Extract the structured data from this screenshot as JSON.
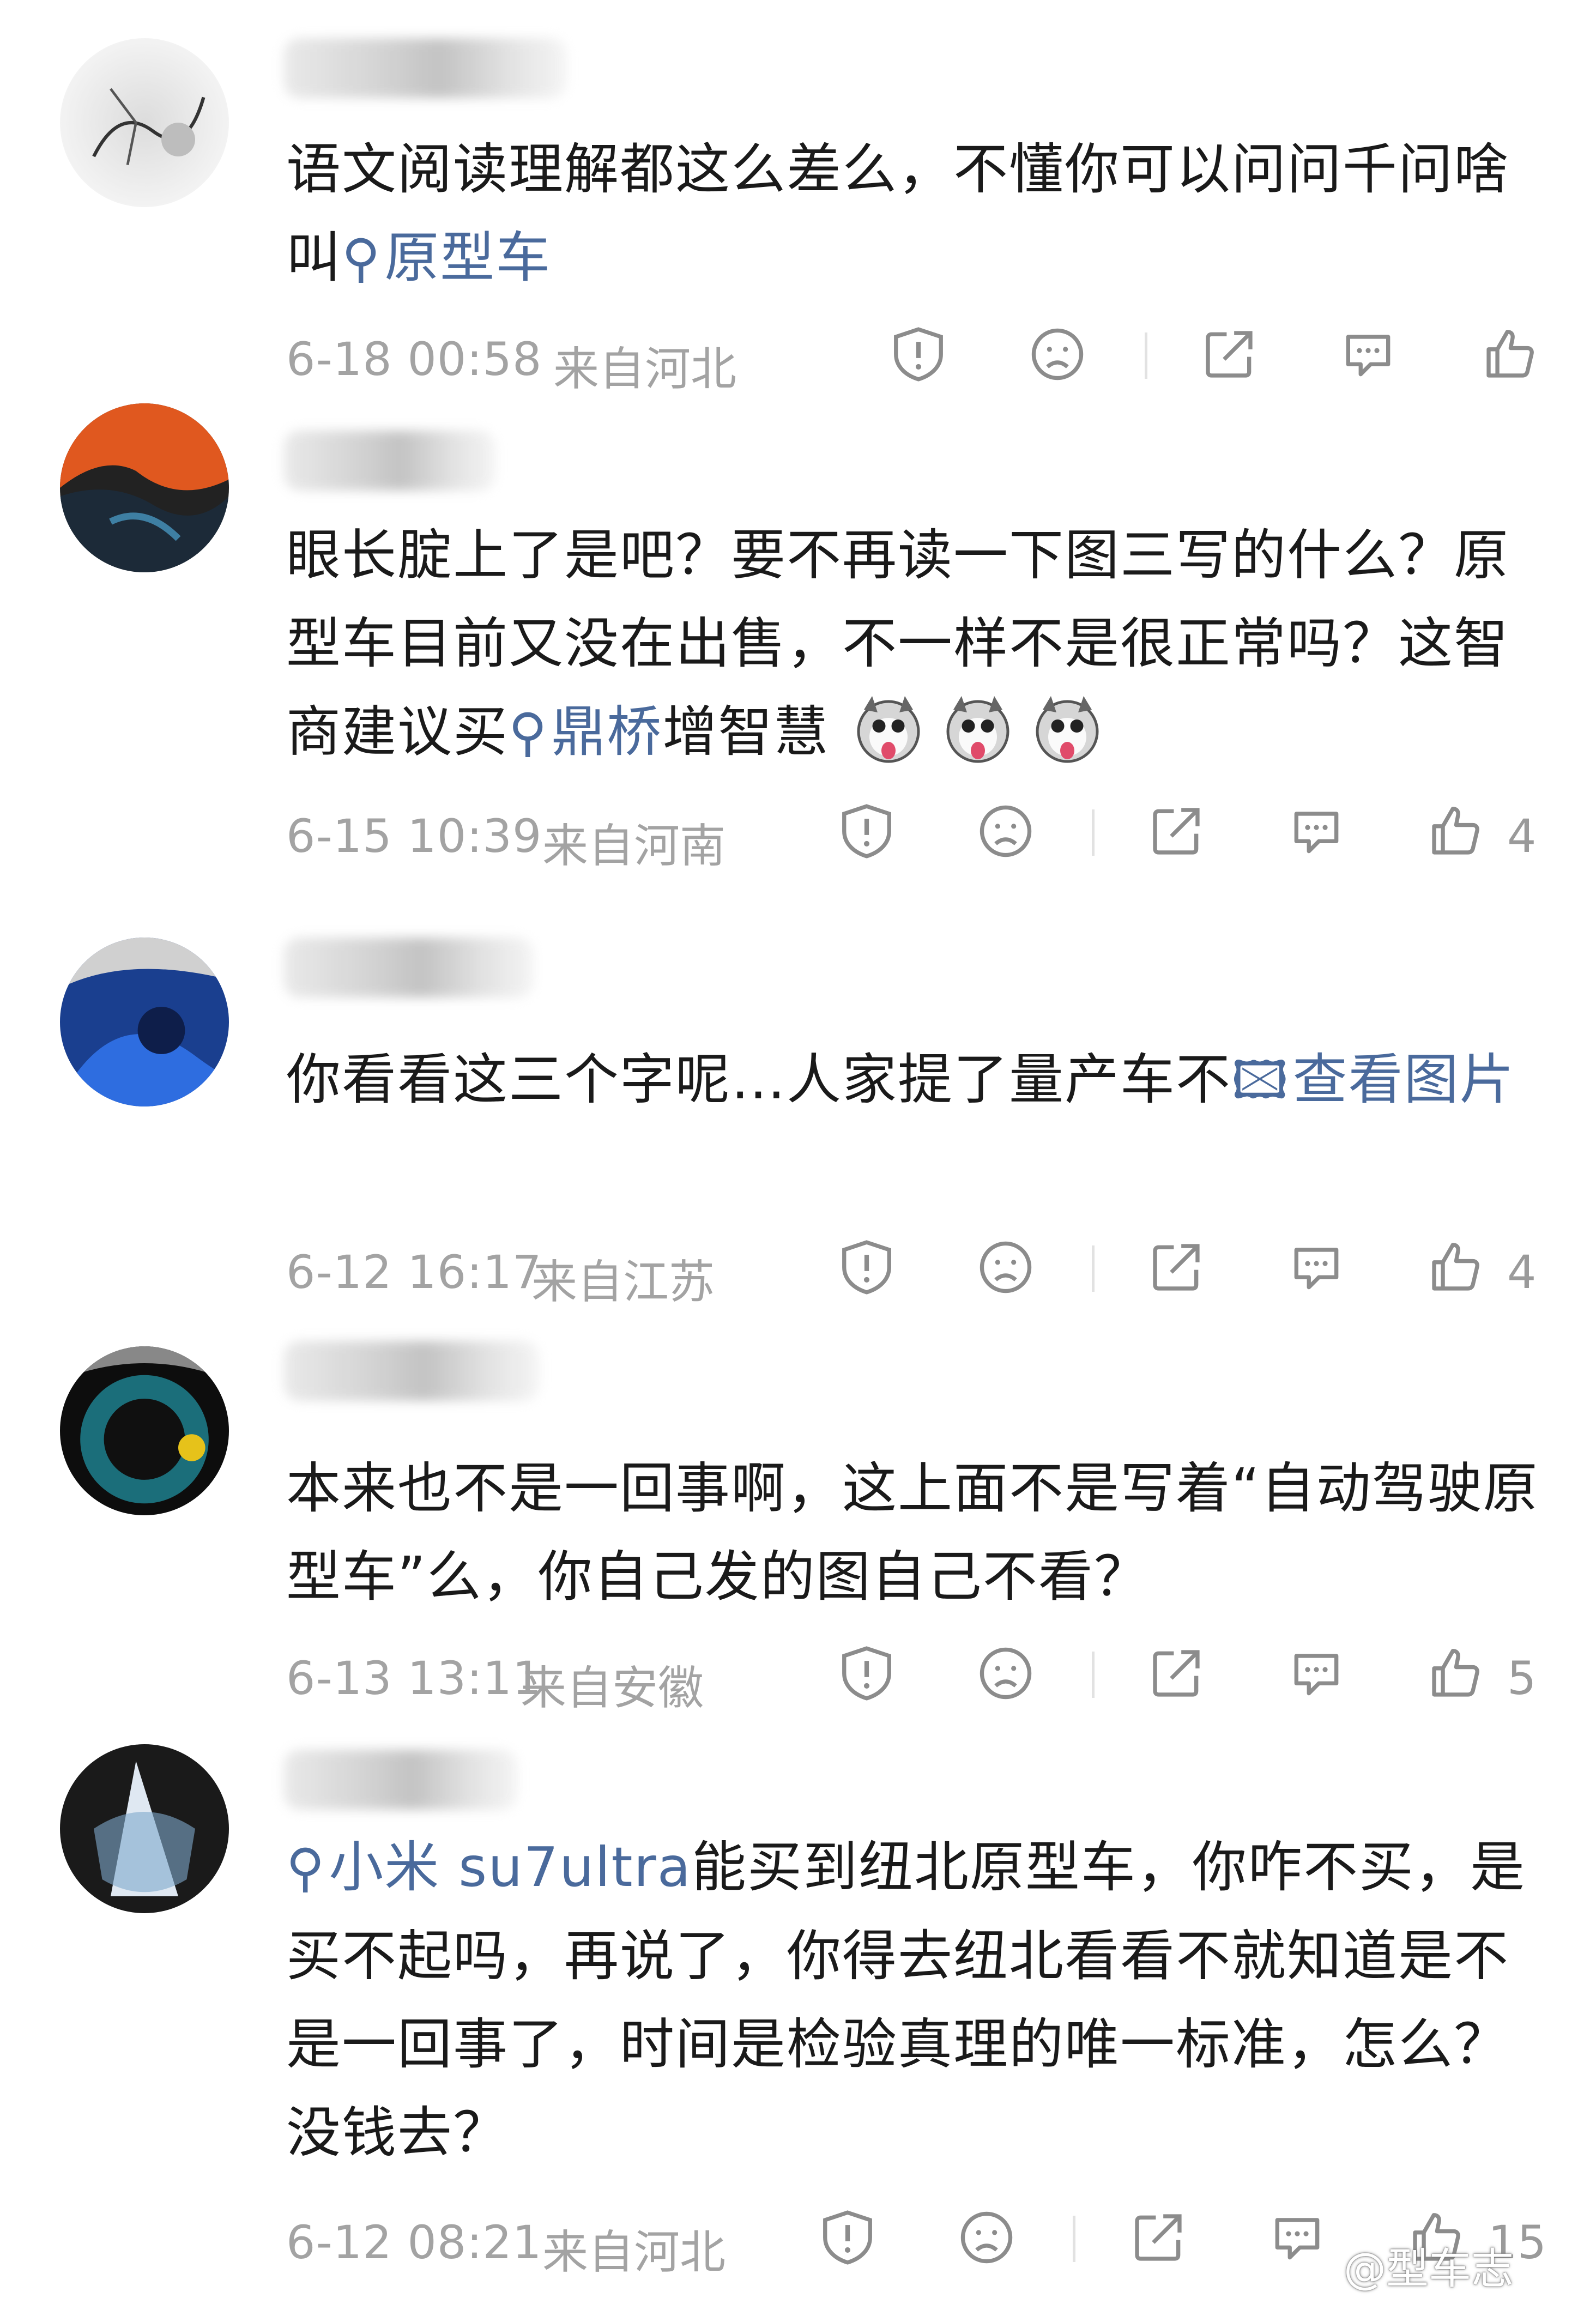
{
  "comments": [
    {
      "text_parts": [
        "语文阅读理解都这么差么，不懂你可以问问千问啥叫",
        ""
      ],
      "tag": "原型车",
      "time": "6-18 00:58",
      "location": "来自河北",
      "like_count": ""
    },
    {
      "text_a": "眼长腚上了是吧？要不再读一下图三写的什么？原型车目前又没在出售，不一样不是很正常吗？这智商建议买",
      "tag": "鼎桥",
      "text_b": "增智慧",
      "time": "6-15 10:39",
      "location": "来自河南",
      "like_count": "4"
    },
    {
      "text_a": "你看看这三个字呢…人家提了量产车不",
      "tag": "查看图片",
      "time": "6-12 16:17",
      "location": "来自江苏",
      "like_count": "4"
    },
    {
      "text_a": "本来也不是一回事啊，这上面不是写着“自动驾驶原型车”么，你自己发的图自己不看？",
      "time": "6-13 13:11",
      "location": "来自安徽",
      "like_count": "5"
    },
    {
      "tag": "小米 su7ultra",
      "text_b": "能买到纽北原型车，你咋不买，是买不起吗，再说了，你得去纽北看看不就知道是不是一回事了，时间是检验真理的唯一标准，怎么？没钱去？",
      "time": "6-12 08:21",
      "location": "来自河北",
      "like_count": "15"
    }
  ],
  "icons": {
    "report": "report-icon",
    "dislike": "dislike-icon",
    "share": "share-icon",
    "reply": "reply-icon",
    "like": "like-icon",
    "search_tag": "search-icon",
    "image_tag": "image-icon"
  },
  "colors": {
    "link": "#4a6a9c",
    "meta": "#a3a3a3",
    "icon": "#8c8c8c"
  },
  "watermark": "@型车志"
}
